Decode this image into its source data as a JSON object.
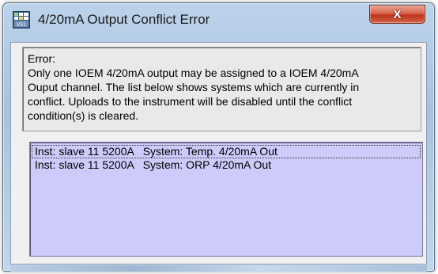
{
  "window": {
    "title": "4/20mA Output Conflict Error",
    "close_label": "X"
  },
  "message": {
    "text": "Error:\nOnly one IOEM 4/20mA output may be assigned to a IOEM 4/20mA\nOuput channel. The list below shows systems which are currently in\nconflict.  Uploads to the instrument will be disabled until the conflict\ncondition(s) is cleared."
  },
  "conflicts": [
    {
      "text": "Inst: slave 11 5200A   System: Temp. 4/20mA Out"
    },
    {
      "text": "Inst: slave 11 5200A   System: ORP 4/20mA Out"
    }
  ],
  "colors": {
    "list_background": "#cccbf9",
    "close_button": "#c0331b",
    "titlebar": "#bcd3ea"
  },
  "icons": {
    "app": "app-grid-icon",
    "close": "close-icon"
  }
}
